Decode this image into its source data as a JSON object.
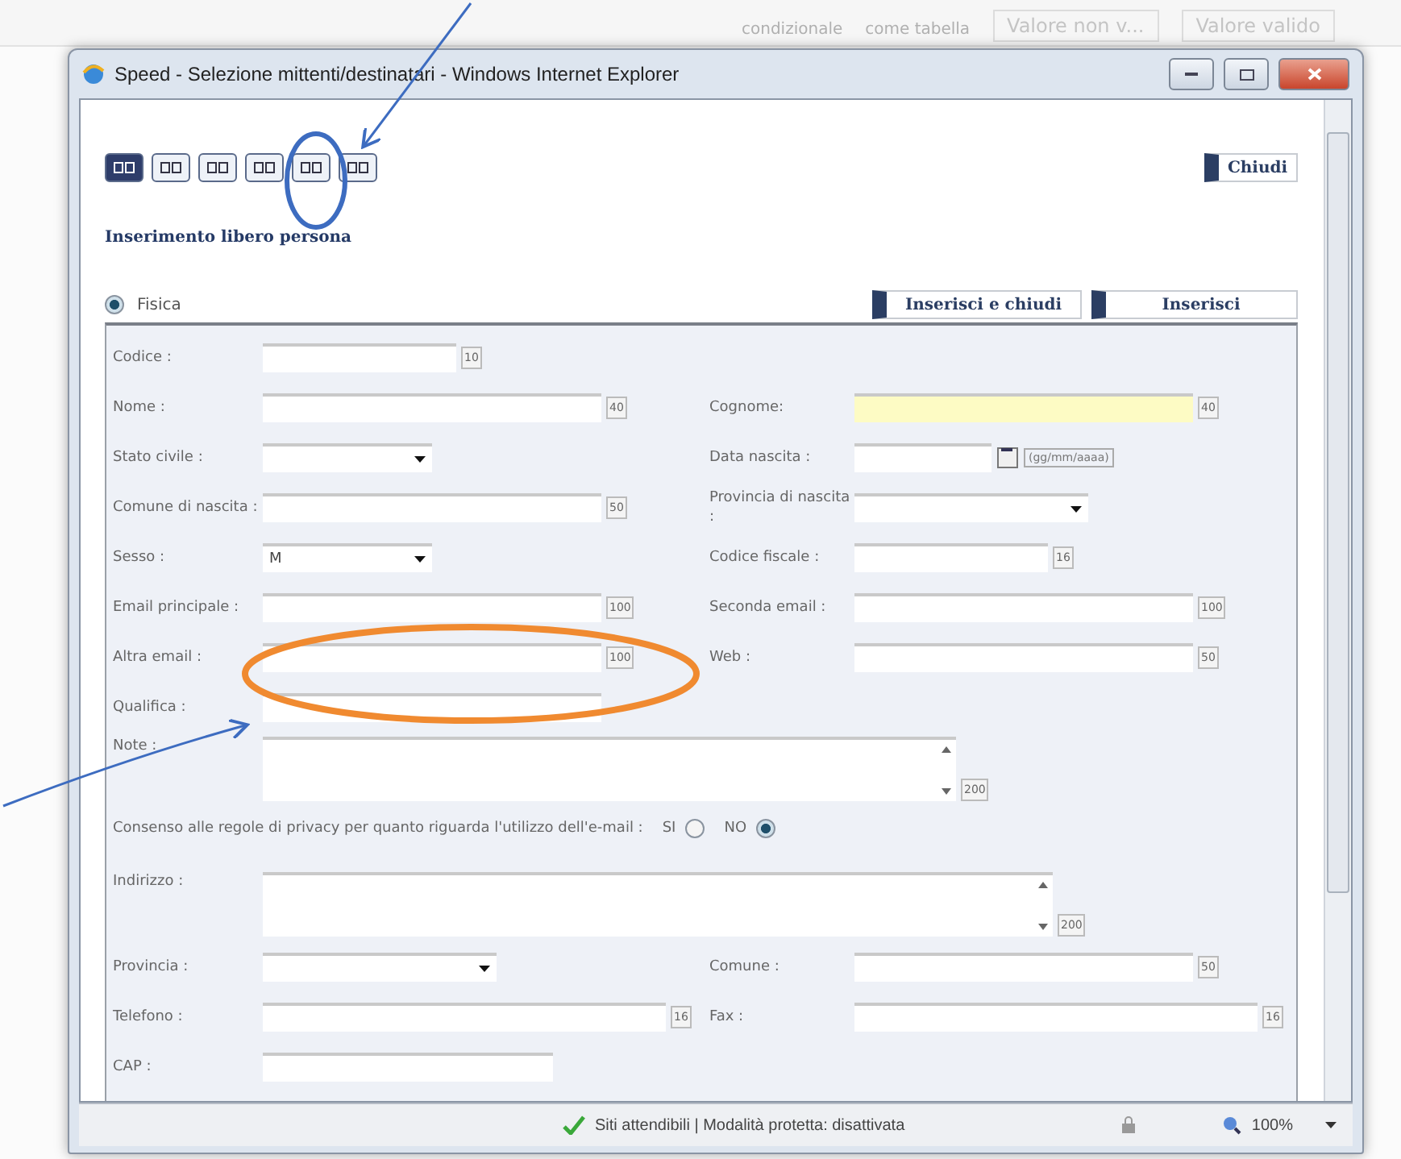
{
  "background_ribbon": [
    "condizionale",
    "come tabella",
    "Valore non v...",
    "Valore valido"
  ],
  "window": {
    "title": "Speed - Selezione mittenti/destinatari - Windows Internet Explorer"
  },
  "close_button": "Chiudi",
  "section_title": "Inserimento libero persona",
  "person_type": {
    "label": "Fisica",
    "selected": true
  },
  "actions": [
    "Inserisci e chiudi",
    "Inserisci"
  ],
  "rows": [
    {
      "kind": "pair",
      "left": {
        "label": "Codice :",
        "kind": "text",
        "maxlen": "10"
      }
    },
    {
      "kind": "pair",
      "left": {
        "label": "Nome :",
        "kind": "text",
        "maxlen": "40"
      },
      "right": {
        "label": "Cognome:",
        "kind": "text",
        "maxlen": "40",
        "highlighted": true
      }
    },
    {
      "kind": "pair",
      "left": {
        "label": "Stato civile :",
        "kind": "select"
      },
      "right": {
        "label": "Data nascita :",
        "kind": "date",
        "hint": "(gg/mm/aaaa)"
      }
    },
    {
      "kind": "pair",
      "left": {
        "label": "Comune di nascita :",
        "kind": "text",
        "maxlen": "50"
      },
      "right": {
        "label": "Provincia di nascita :",
        "kind": "select"
      }
    },
    {
      "kind": "pair",
      "left": {
        "label": "Sesso :",
        "kind": "select",
        "value": "M"
      },
      "right": {
        "label": "Codice fiscale :",
        "kind": "text",
        "maxlen": "16"
      }
    },
    {
      "kind": "pair",
      "left": {
        "label": "Email principale :",
        "kind": "text",
        "maxlen": "100"
      },
      "right": {
        "label": "Seconda email :",
        "kind": "text",
        "maxlen": "100"
      }
    },
    {
      "kind": "pair",
      "left": {
        "label": "Altra email :",
        "kind": "text",
        "maxlen": "100"
      },
      "right": {
        "label": "Web :",
        "kind": "text",
        "maxlen": "50"
      }
    },
    {
      "kind": "pair",
      "left": {
        "label": "Qualifica :",
        "kind": "text"
      }
    },
    {
      "kind": "textarea",
      "label": "Note :",
      "maxlen": "200"
    },
    {
      "kind": "consent",
      "label": "Consenso alle regole di privacy per quanto riguarda l'utilizzo dell'e-mail :",
      "options": [
        {
          "label": "SI",
          "selected": false
        },
        {
          "label": "NO",
          "selected": true
        }
      ]
    },
    {
      "kind": "textarea",
      "label": "Indirizzo :",
      "maxlen": "200"
    },
    {
      "kind": "pair",
      "left": {
        "label": "Provincia :",
        "kind": "select"
      },
      "right": {
        "label": "Comune :",
        "kind": "text",
        "maxlen": "50"
      }
    },
    {
      "kind": "pair",
      "left": {
        "label": "Telefono :",
        "kind": "text",
        "maxlen": "16"
      },
      "right": {
        "label": "Fax :",
        "kind": "text",
        "maxlen": "16"
      }
    },
    {
      "kind": "pair",
      "left": {
        "label": "CAP :",
        "kind": "text"
      }
    }
  ],
  "status_bar": {
    "security": "Siti attendibili | Modalità protetta: disattivata",
    "zoom": "100%"
  }
}
